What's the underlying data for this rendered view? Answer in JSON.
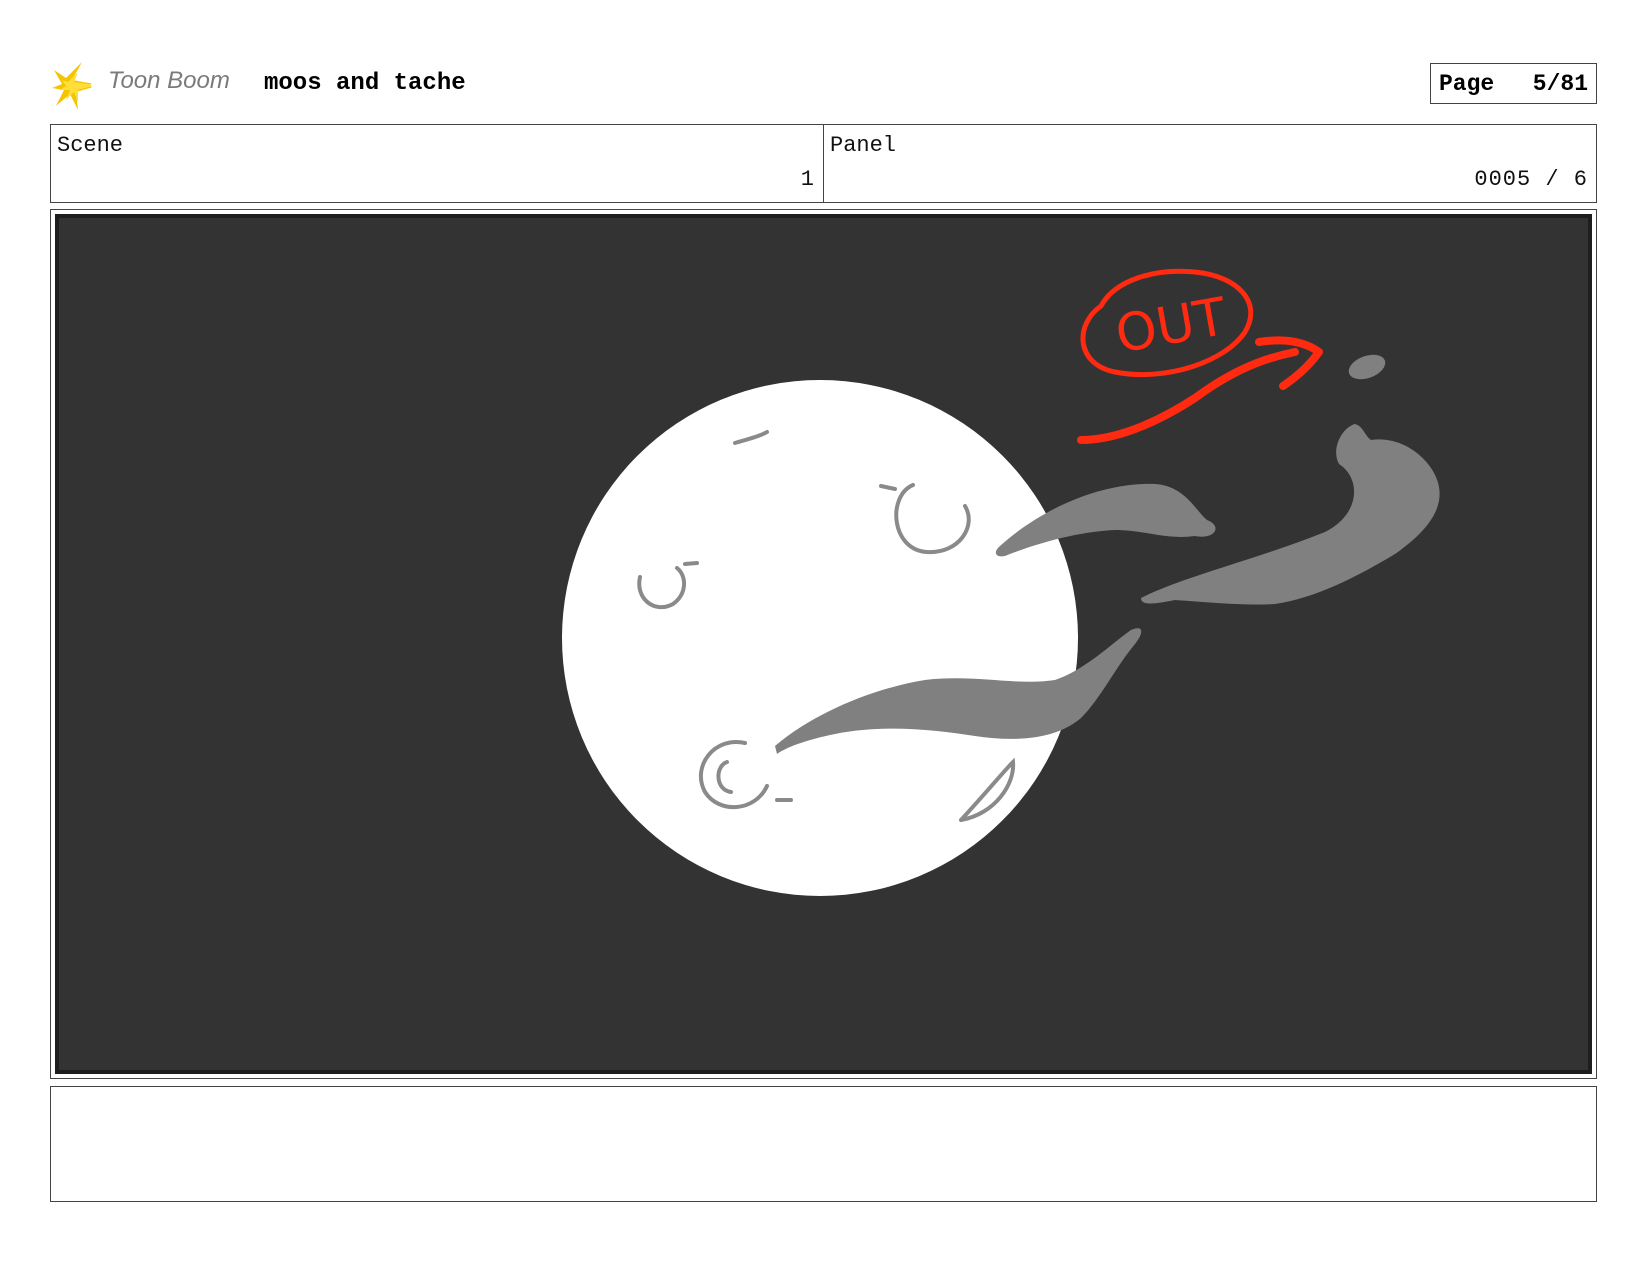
{
  "header": {
    "logo_text": "Toon Boom",
    "project_title": "moos and tache",
    "page_label": "Page",
    "page_value": "5/81"
  },
  "info": {
    "scene_label": "Scene",
    "scene_value": "1",
    "panel_label": "Panel",
    "panel_value": "0005 / 6"
  },
  "panel_art": {
    "annotation_text": "OUT",
    "background_color": "#333333",
    "moon_color": "#ffffff",
    "smoke_color": "#808080",
    "annotation_color": "#ff2a10"
  },
  "notes": {
    "text": ""
  }
}
